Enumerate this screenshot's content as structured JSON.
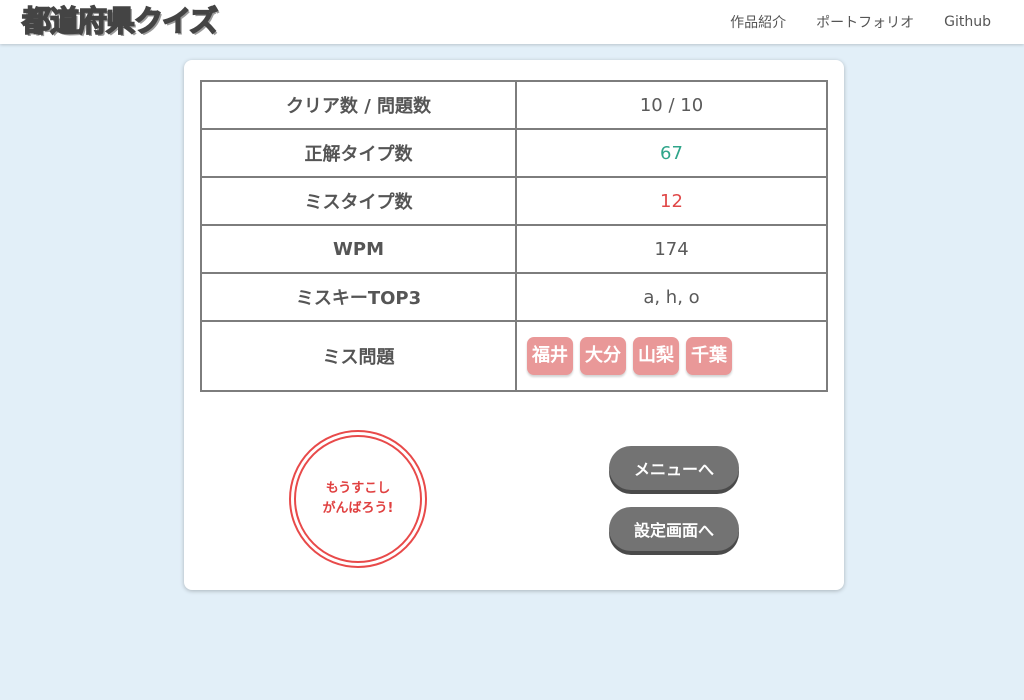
{
  "header": {
    "logo_part1": "都",
    "logo_accent": "道",
    "logo_part2": "府県クイズ",
    "nav": [
      "作品紹介",
      "ポートフォリオ",
      "Github"
    ]
  },
  "results": {
    "clear_label": "クリア数 / 問題数",
    "clear_value": "10 / 10",
    "correct_label": "正解タイプ数",
    "correct_value": "67",
    "miss_label": "ミスタイプ数",
    "miss_value": "12",
    "wpm_label": "WPM",
    "wpm_value": "174",
    "miss_keys_label": "ミスキーTOP3",
    "miss_keys_value": "a, h, o",
    "miss_questions_label": "ミス問題",
    "miss_questions": [
      "福井",
      "大分",
      "山梨",
      "千葉"
    ]
  },
  "stamp": {
    "line1": "もうすこし",
    "line2": "がんばろう!"
  },
  "buttons": {
    "menu": "メニューへ",
    "settings": "設定画面へ"
  },
  "colors": {
    "background": "#e2eff8",
    "correct": "#2fa58a",
    "miss": "#e04848",
    "chip": "#e99898",
    "stamp": "#e84a4a",
    "button": "#737373"
  }
}
